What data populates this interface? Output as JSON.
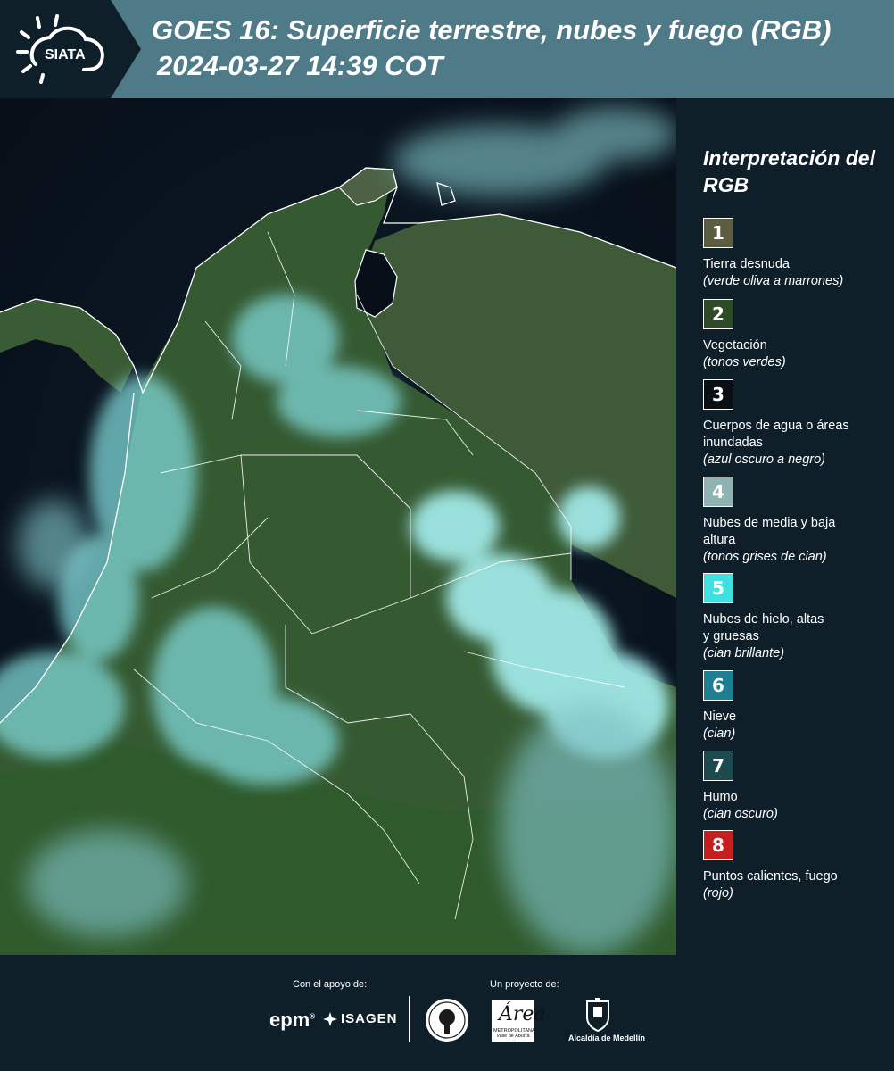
{
  "header": {
    "logo_text": "SIATA",
    "title_line1": "GOES 16: Superficie terrestre, nubes y fuego (RGB)",
    "title_line2": "2024-03-27 14:39 COT"
  },
  "legend": {
    "title": "Interpretación del RGB",
    "items": [
      {
        "number": "1",
        "label": "Tierra desnuda",
        "note": "(verde oliva a marrones)",
        "color": "#5b5d40"
      },
      {
        "number": "2",
        "label": "Vegetación",
        "note": "(tonos verdes)",
        "color": "#2f4a26"
      },
      {
        "number": "3",
        "label": "Cuerpos de agua o áreas inundadas",
        "note": "(azul oscuro a negro)",
        "color": "#0a0f14"
      },
      {
        "number": "4",
        "label": "Nubes de media y baja altura",
        "note": "(tonos grises de cian)",
        "color": "#8fb3b3"
      },
      {
        "number": "5",
        "label": "Nubes de hielo, altas y gruesas",
        "note": "(cian brillante)",
        "color": "#3fe0e0"
      },
      {
        "number": "6",
        "label": "Nieve",
        "note": "(cian)",
        "color": "#1e7f92"
      },
      {
        "number": "7",
        "label": "Humo",
        "note": "(cian oscuro)",
        "color": "#1c4a4f"
      },
      {
        "number": "8",
        "label": "Puntos calientes, fuego",
        "note": "(rojo)",
        "color": "#c41e1e"
      }
    ]
  },
  "footer": {
    "support_label": "Con el apoyo de:",
    "project_label": "Un proyecto de:",
    "sponsors": [
      "epm",
      "ISAGEN"
    ],
    "partners": {
      "area_mark": "Área",
      "area_text": "METROPOLITANA Valle de Aburrá",
      "alcaldia": "Alcaldía de Medellín"
    }
  },
  "icons": [
    "sun-cloud-icon",
    "isagen-icon",
    "seal-icon",
    "coat-of-arms-icon"
  ]
}
